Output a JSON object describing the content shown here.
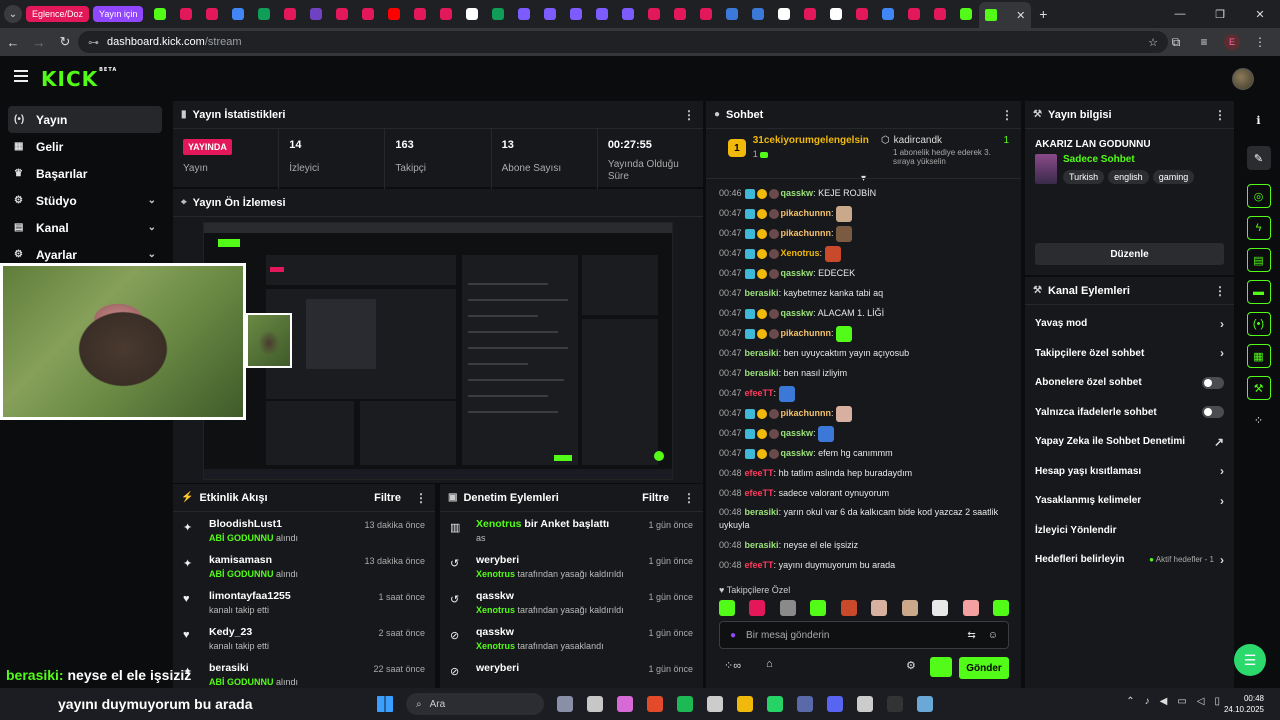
{
  "browser": {
    "tab_pills": [
      {
        "label": "Eglence/Doz",
        "color": "#e2185b"
      },
      {
        "label": "Yayın için",
        "color": "#9147ff"
      }
    ],
    "favicon_colors": [
      "#53fc18",
      "#e2185b",
      "#e2185b",
      "#4285f4",
      "#0f9d58",
      "#e2185b",
      "#6f42c1",
      "#e2185b",
      "#e2185b",
      "#ff0000",
      "#e2185b",
      "#e2185b",
      "#ffffff",
      "#0f9d58",
      "#7c5cff",
      "#7c5cff",
      "#7c5cff",
      "#7c5cff",
      "#7c5cff",
      "#e2185b",
      "#e2185b",
      "#e2185b",
      "#3c78d8",
      "#3c78d8",
      "#ffffff",
      "#e2185b",
      "#ffffff",
      "#e2185b",
      "#4285f4",
      "#e2185b",
      "#e2185b",
      "#53fc18"
    ],
    "active_tab_icon": "kick-icon",
    "url_host": "dashboard.kick.com",
    "url_path": "/stream",
    "profile_initial": "E"
  },
  "kick": {
    "logo": "KICK",
    "logo_sup": "BETA"
  },
  "sidebar": {
    "items": [
      {
        "label": "Yayın",
        "icon": "(•)"
      },
      {
        "label": "Gelir",
        "icon": "▦"
      },
      {
        "label": "Başarılar",
        "icon": "♛"
      },
      {
        "label": "Stüdyo",
        "icon": "⚙"
      },
      {
        "label": "Kanal",
        "icon": "▤"
      },
      {
        "label": "Ayarlar",
        "icon": "⚙"
      }
    ]
  },
  "stats": {
    "title": "Yayın İstatistikleri",
    "live_badge": "YAYINDA",
    "live_label": "Yayın",
    "viewers_value": "14",
    "viewers_label": "İzleyici",
    "followers_value": "163",
    "followers_label": "Takipçi",
    "subs_value": "13",
    "subs_label": "Abone Sayısı",
    "duration_value": "00:27:55",
    "duration_label": "Yayında Olduğu Süre"
  },
  "preview": {
    "title": "Yayın Ön İzlemesi"
  },
  "activity": {
    "title": "Etkinlik Akışı",
    "filter": "Filtre",
    "items": [
      {
        "name": "BloodishLust1",
        "sub_hl": "ABİ GODUNNU",
        "sub": " alındı",
        "time": "13 dakika önce",
        "icon": "✦"
      },
      {
        "name": "kamisamasn",
        "sub_hl": "ABİ GODUNNU",
        "sub": " alındı",
        "time": "13 dakika önce",
        "icon": "✦"
      },
      {
        "name": "limontayfaa1255",
        "sub_hl": "",
        "sub": "kanalı takip etti",
        "time": "1 saat önce",
        "icon": "♥"
      },
      {
        "name": "Kedy_23",
        "sub_hl": "",
        "sub": "kanalı takip etti",
        "time": "2 saat önce",
        "icon": "♥"
      },
      {
        "name": "berasiki",
        "sub_hl": "ABİ GODUNNU",
        "sub": " alındı",
        "time": "22 saat önce",
        "icon": "✦"
      }
    ]
  },
  "moderation": {
    "title": "Denetim Eylemleri",
    "filter": "Filtre",
    "items": [
      {
        "name": "Xenotrus",
        "name_suffix": " bir Anket başlattı",
        "sub_hl": "",
        "sub": "as",
        "time": "1 gün önce",
        "icon": "▥"
      },
      {
        "name": "weryberi",
        "name_suffix": "",
        "sub_hl": "Xenotrus",
        "sub": " tarafından yasağı kaldırıldı",
        "time": "1 gün önce",
        "icon": "↺"
      },
      {
        "name": "qasskw",
        "name_suffix": "",
        "sub_hl": "Xenotrus",
        "sub": " tarafından yasağı kaldırıldı",
        "time": "1 gün önce",
        "icon": "↺"
      },
      {
        "name": "qasskw",
        "name_suffix": "",
        "sub_hl": "Xenotrus",
        "sub": " tarafından yasaklandı",
        "time": "1 gün önce",
        "icon": "⊘"
      },
      {
        "name": "weryberi",
        "name_suffix": "",
        "sub_hl": "",
        "sub": "",
        "time": "1 gün önce",
        "icon": "⊘"
      }
    ]
  },
  "chat": {
    "title": "Sohbet",
    "pinned_user": "31cekiyorumgelengelsin",
    "pinned_count": "1",
    "pinned_right_user": "kadircandk",
    "pinned_right_count": "1",
    "pinned_right_text": "1 abonelik hediye ederek 3. sıraya yükselin",
    "messages": [
      {
        "time": "00:46",
        "user": "qasskw",
        "color": "#9be37a",
        "text": "KEJE ROJBİN",
        "emote": ""
      },
      {
        "time": "00:47",
        "user": "pikachunnn",
        "color": "#f4c16c",
        "text": "",
        "emote": "#c9a98a"
      },
      {
        "time": "00:47",
        "user": "pikachunnn",
        "color": "#f4c16c",
        "text": "",
        "emote": "#7a5a40"
      },
      {
        "time": "00:47",
        "user": "Xenotrus",
        "color": "#f0b90b",
        "text": "",
        "emote": "#c84a2a"
      },
      {
        "time": "00:47",
        "user": "qasskw",
        "color": "#9be37a",
        "text": "EDECEK",
        "emote": ""
      },
      {
        "time": "00:47",
        "user": "berasiki",
        "color": "#9be37a",
        "text": "kaybetmez kanka tabi aq",
        "emote": ""
      },
      {
        "time": "00:47",
        "user": "qasskw",
        "color": "#9be37a",
        "text": "ALACAM 1. LİĞİ",
        "emote": ""
      },
      {
        "time": "00:47",
        "user": "pikachunnn",
        "color": "#f4c16c",
        "text": "",
        "emote": "#53fc18"
      },
      {
        "time": "00:47",
        "user": "berasiki",
        "color": "#9be37a",
        "text": "ben uyuycaktım yayın açıyosub",
        "emote": ""
      },
      {
        "time": "00:47",
        "user": "berasiki",
        "color": "#9be37a",
        "text": "ben nasıl izliyim",
        "emote": ""
      },
      {
        "time": "00:47",
        "user": "efeeTT",
        "color": "#ff3b5c",
        "text": "",
        "emote": "#3c78d8"
      },
      {
        "time": "00:47",
        "user": "pikachunnn",
        "color": "#f4c16c",
        "text": "",
        "emote": "#d8b0a0"
      },
      {
        "time": "00:47",
        "user": "qasskw",
        "color": "#9be37a",
        "text": "",
        "emote": "#3c78d8"
      },
      {
        "time": "00:47",
        "user": "qasskw",
        "color": "#9be37a",
        "text": "efem hg canımmm",
        "emote": ""
      },
      {
        "time": "00:48",
        "user": "efeeTT",
        "color": "#ff3b5c",
        "text": "hb tatlım aslında hep buradaydım",
        "emote": ""
      },
      {
        "time": "00:48",
        "user": "efeeTT",
        "color": "#ff3b5c",
        "text": "sadece valorant oynuyorum",
        "emote": ""
      },
      {
        "time": "00:48",
        "user": "berasiki",
        "color": "#9be37a",
        "text": "yarın okul var 6 da kalkıcam bide kod yazcaz 2 saatlik uykuyla",
        "emote": ""
      },
      {
        "time": "00:48",
        "user": "berasiki",
        "color": "#9be37a",
        "text": "neyse el ele işsiziz",
        "emote": ""
      },
      {
        "time": "00:48",
        "user": "efeeTT",
        "color": "#ff3b5c",
        "text": "yayını duymuyorum bu arada",
        "emote": ""
      }
    ],
    "followers_only": "Takipçilere Özel",
    "emote_colors": [
      "#53fc18",
      "#e2185b",
      "#8a8a8a",
      "#53fc18",
      "#c84a2a",
      "#d8b0a0",
      "#c9a98a",
      "#e8e8e8",
      "#f4a0a0",
      "#53fc18"
    ],
    "input_placeholder": "Bir mesaj gönderin",
    "send_label": "Gönder"
  },
  "stream_info": {
    "title": "Yayın bilgisi",
    "stream_title": "AKARIZ LAN GODUNNU",
    "category": "Sadece Sohbet",
    "tags": [
      "Turkish",
      "english",
      "gaming"
    ],
    "edit_label": "Düzenle"
  },
  "channel_actions": {
    "title": "Kanal Eylemleri",
    "rows": [
      {
        "label": "Yavaş mod",
        "right": "›"
      },
      {
        "label": "Takipçilere özel sohbet",
        "right": "›"
      },
      {
        "label": "Abonelere özel sohbet",
        "right": "toggle"
      },
      {
        "label": "Yalnızca ifadelerle sohbet",
        "right": "toggle"
      },
      {
        "label": "Yapay Zeka ile Sohbet Denetimi",
        "right": "↗"
      },
      {
        "label": "Hesap yaşı kısıtlaması",
        "right": "›"
      },
      {
        "label": "Yasaklanmış kelimeler",
        "right": "›"
      },
      {
        "label": "İzleyici Yönlendir",
        "right": ""
      },
      {
        "label": "Hedefleri belirleyin",
        "right": "›"
      }
    ],
    "goals_status": "Aktif hedefler - 1"
  },
  "overlay": {
    "line1_user": "berasiki:",
    "line1_text": " neyse el ele işsiziz",
    "line2_text": "yayını duymuyorum bu arada"
  },
  "taskbar": {
    "search_placeholder": "Ara",
    "time": "00:48",
    "date": "24.10.2025"
  },
  "accent": "#53fc18"
}
